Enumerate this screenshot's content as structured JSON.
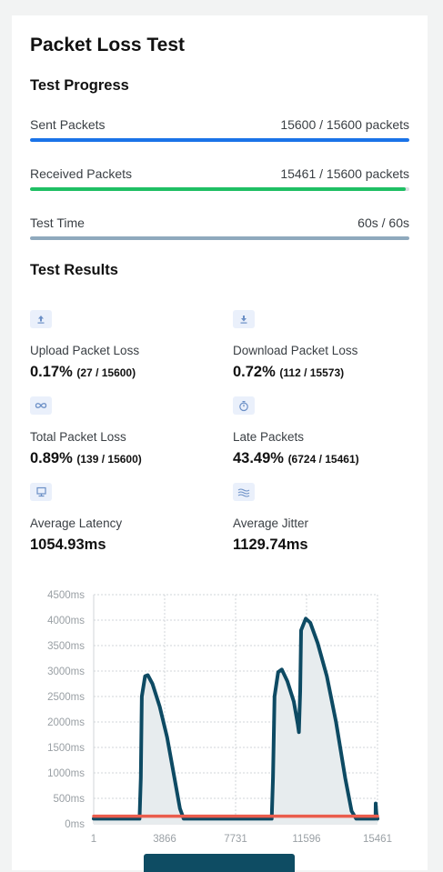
{
  "page": {
    "title": "Packet Loss Test"
  },
  "progress": {
    "heading": "Test Progress",
    "items": [
      {
        "label": "Sent Packets",
        "value": "15600 / 15600 packets",
        "fraction": 1.0,
        "color": "#1a73e8"
      },
      {
        "label": "Received Packets",
        "value": "15461 / 15600 packets",
        "fraction": 0.991,
        "color": "#1fbf64"
      },
      {
        "label": "Test Time",
        "value": "60s / 60s",
        "fraction": 1.0,
        "color": "#8fa9bd"
      }
    ]
  },
  "results": {
    "heading": "Test Results",
    "metrics": [
      {
        "icon": "upload-icon",
        "label": "Upload Packet Loss",
        "value": "0.17%",
        "detail": "(27 / 15600)"
      },
      {
        "icon": "download-icon",
        "label": "Download Packet Loss",
        "value": "0.72%",
        "detail": "(112 / 15573)"
      },
      {
        "icon": "infinity-icon",
        "label": "Total Packet Loss",
        "value": "0.89%",
        "detail": "(139 / 15600)"
      },
      {
        "icon": "stopwatch-icon",
        "label": "Late Packets",
        "value": "43.49%",
        "detail": "(6724 / 15461)"
      },
      {
        "icon": "monitor-icon",
        "label": "Average Latency",
        "value": "1054.93ms",
        "detail": ""
      },
      {
        "icon": "waves-icon",
        "label": "Average Jitter",
        "value": "1129.74ms",
        "detail": ""
      }
    ]
  },
  "chart_data": {
    "type": "line",
    "title": "",
    "xlabel": "",
    "ylabel": "",
    "y_tick_labels": [
      "0ms",
      "500ms",
      "1000ms",
      "1500ms",
      "2000ms",
      "2500ms",
      "3000ms",
      "3500ms",
      "4000ms",
      "4500ms"
    ],
    "x_tick_labels": [
      "1",
      "3866",
      "7731",
      "11596",
      "15461"
    ],
    "ylim": [
      0,
      4500
    ],
    "xlim": [
      1,
      15461
    ],
    "grid": true,
    "series": [
      {
        "color": "#0d4a63",
        "fill": "#e7ecee",
        "points": [
          [
            1,
            100
          ],
          [
            2500,
            100
          ],
          [
            2570,
            900
          ],
          [
            2620,
            2500
          ],
          [
            2800,
            2900
          ],
          [
            2950,
            2920
          ],
          [
            3200,
            2750
          ],
          [
            3600,
            2300
          ],
          [
            4000,
            1700
          ],
          [
            4400,
            900
          ],
          [
            4700,
            300
          ],
          [
            4900,
            100
          ],
          [
            9700,
            100
          ],
          [
            9770,
            900
          ],
          [
            9850,
            2500
          ],
          [
            10050,
            2980
          ],
          [
            10250,
            3030
          ],
          [
            10550,
            2800
          ],
          [
            10900,
            2400
          ],
          [
            11120,
            1950
          ],
          [
            11180,
            1800
          ],
          [
            11250,
            2600
          ],
          [
            11300,
            3800
          ],
          [
            11550,
            4030
          ],
          [
            11800,
            3950
          ],
          [
            12200,
            3550
          ],
          [
            12700,
            2900
          ],
          [
            13200,
            2000
          ],
          [
            13700,
            900
          ],
          [
            14050,
            250
          ],
          [
            14300,
            100
          ],
          [
            15350,
            100
          ],
          [
            15360,
            400
          ],
          [
            15400,
            200
          ],
          [
            15461,
            100
          ]
        ]
      },
      {
        "color": "#ea5d4d",
        "points": [
          [
            1,
            150
          ],
          [
            15461,
            150
          ]
        ]
      }
    ]
  }
}
